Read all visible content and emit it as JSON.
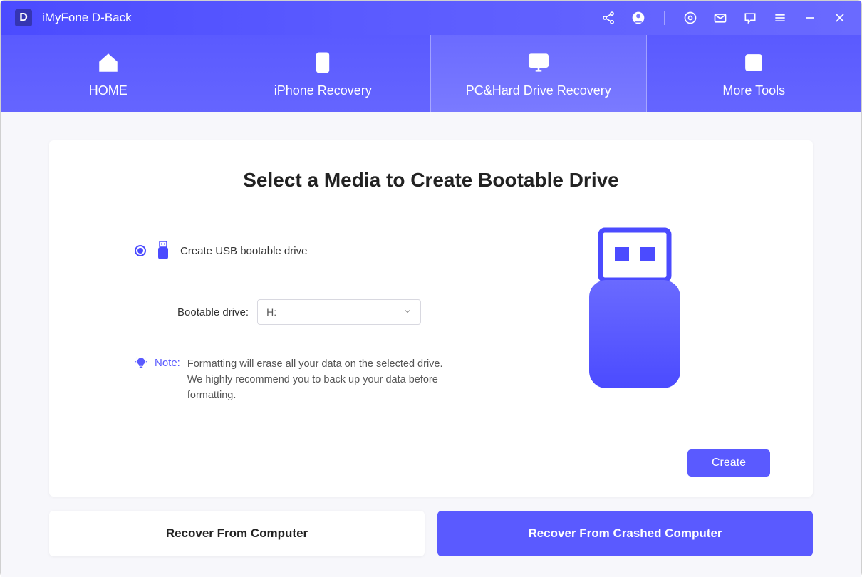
{
  "app": {
    "logo_letter": "D",
    "title": "iMyFone D-Back"
  },
  "nav": {
    "tabs": [
      {
        "label": "HOME"
      },
      {
        "label": "iPhone Recovery"
      },
      {
        "label": "PC&Hard Drive Recovery"
      },
      {
        "label": "More Tools"
      }
    ]
  },
  "main": {
    "heading": "Select a Media to Create Bootable Drive",
    "radio_option_label": "Create USB bootable drive",
    "dropdown_label": "Bootable drive:",
    "dropdown_value": "H:",
    "note_label": "Note:",
    "note_text": "Formatting will erase all your data on the selected drive. We highly recommend you to back up your data before formatting.",
    "create_button": "Create"
  },
  "bottom": {
    "left_label": "Recover From Computer",
    "right_label": "Recover From Crashed Computer"
  }
}
